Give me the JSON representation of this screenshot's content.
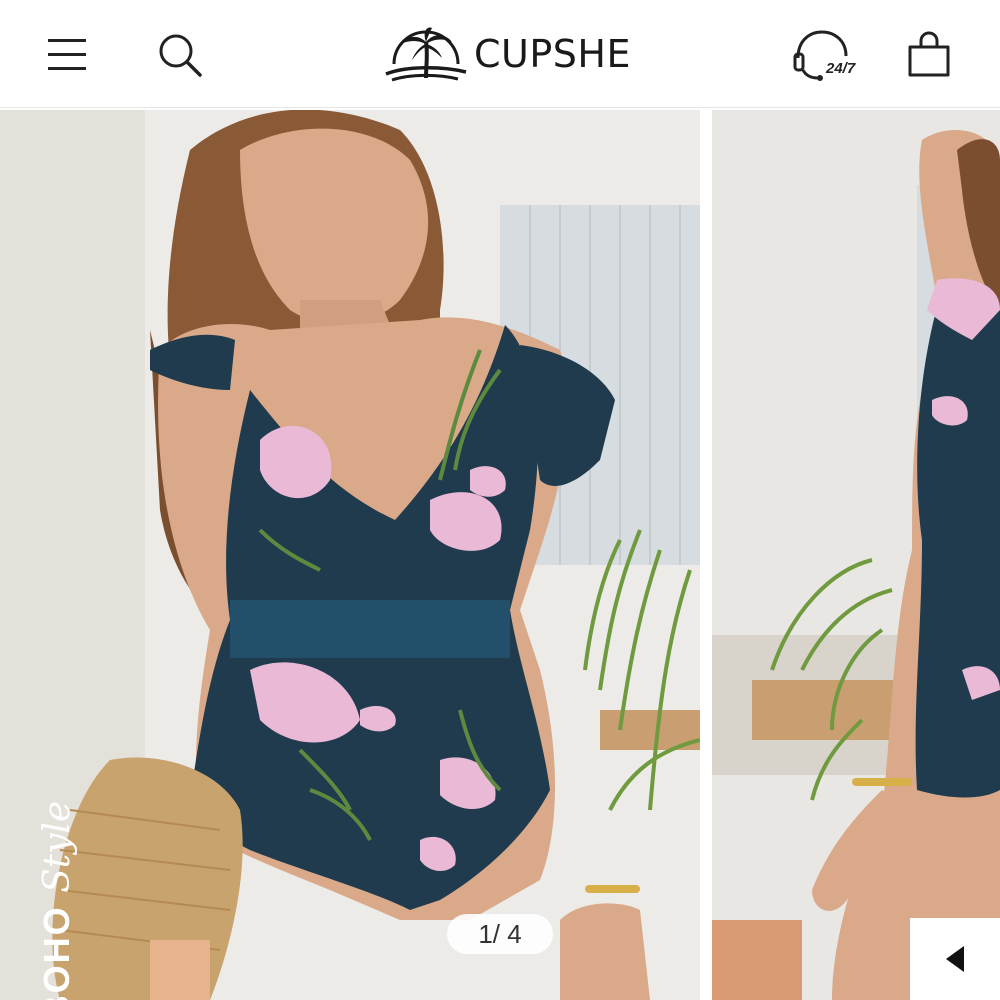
{
  "header": {
    "brand": "CUPSHE",
    "support_label": "24/7",
    "icons": [
      "menu-icon",
      "search-icon",
      "palm-tree-logo-icon",
      "customer-support-icon",
      "shopping-bag-icon"
    ]
  },
  "gallery": {
    "counter": "1/ 4",
    "style_tag_main": "BOHO",
    "style_tag_script": "Style",
    "current_index": 1,
    "total": 4,
    "prev_icon": "caret-left-icon"
  },
  "colors": {
    "swimsuit_navy": "#1f3b4d",
    "floral_pink": "#e9b9d6",
    "leaf_green": "#5c8a3f",
    "skin": "#d9a98a",
    "wall": "#ecebe7"
  }
}
